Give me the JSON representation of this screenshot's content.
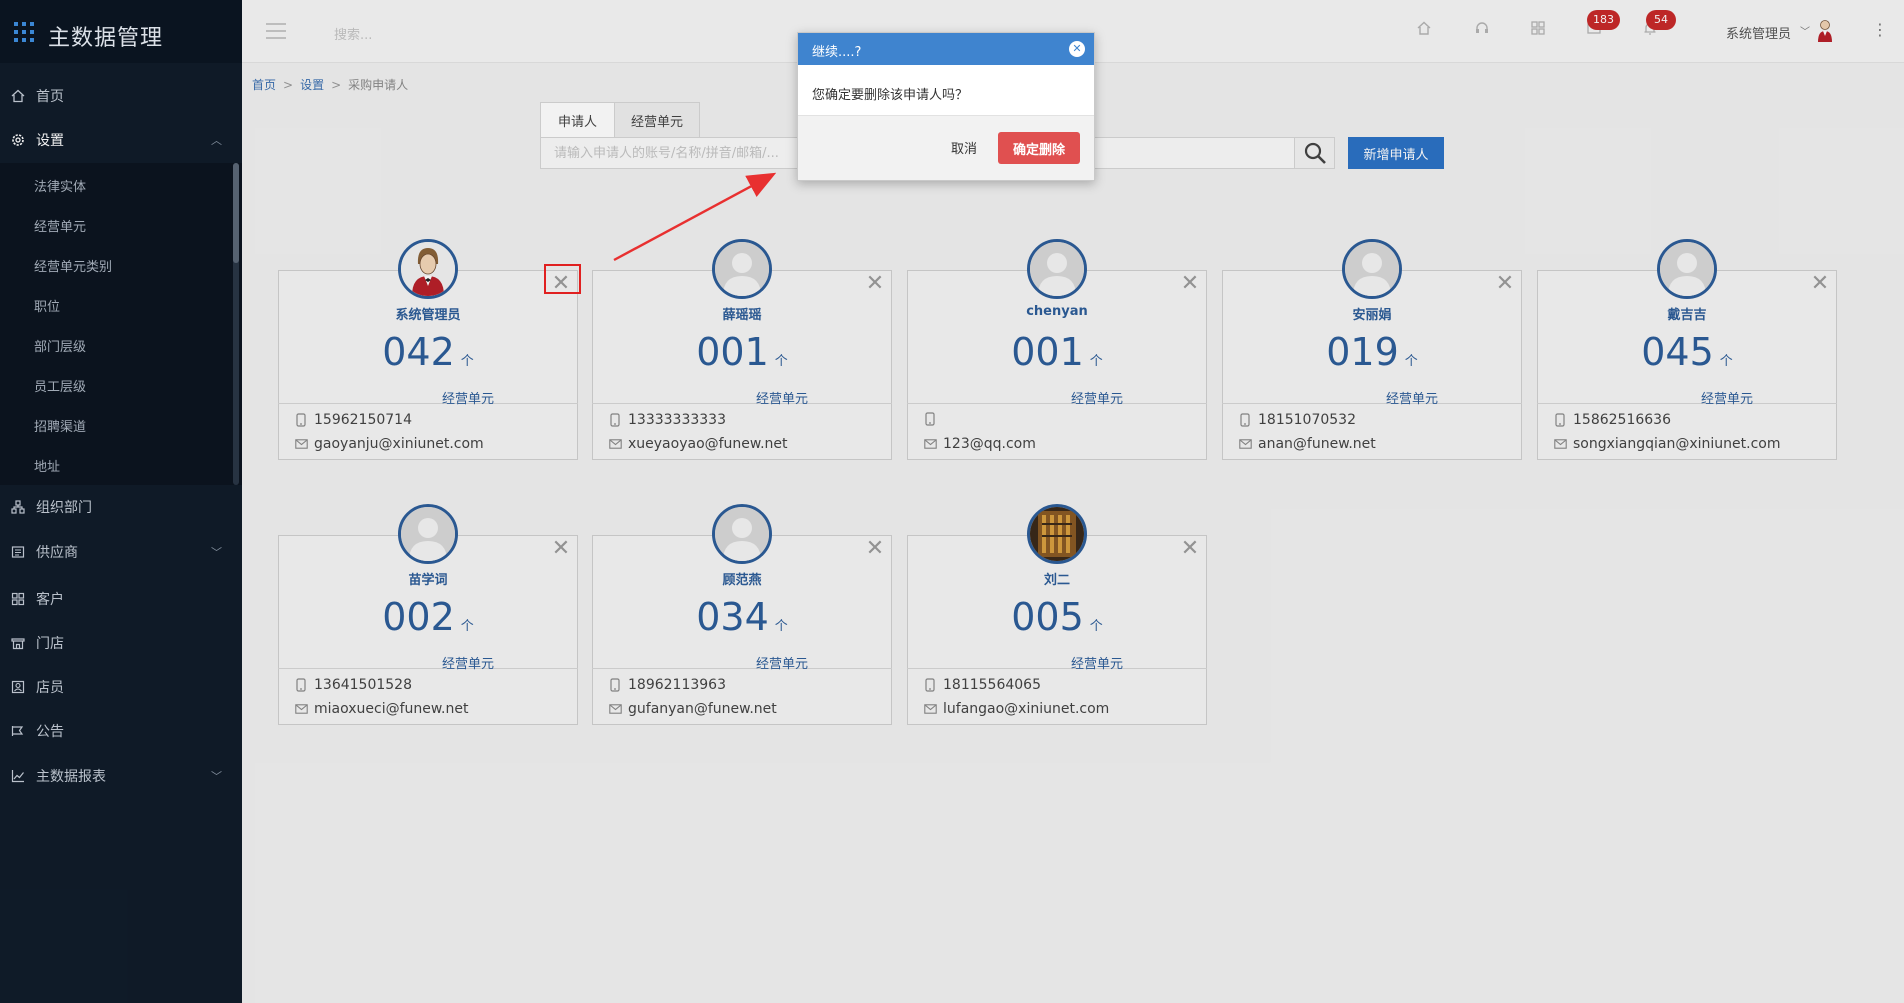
{
  "app": {
    "title": "主数据管理"
  },
  "sidebar": {
    "items": [
      {
        "label": "首页",
        "icon": "home-icon"
      },
      {
        "label": "设置",
        "icon": "gear-icon",
        "expanded": true
      },
      {
        "label": "组织部门",
        "icon": "org-icon"
      },
      {
        "label": "供应商",
        "icon": "supplier-icon"
      },
      {
        "label": "客户",
        "icon": "customer-icon"
      },
      {
        "label": "门店",
        "icon": "store-icon"
      },
      {
        "label": "店员",
        "icon": "clerk-icon"
      },
      {
        "label": "公告",
        "icon": "announcement-icon"
      },
      {
        "label": "主数据报表",
        "icon": "chart-icon"
      }
    ],
    "settings_submenu": [
      "法律实体",
      "经营单元",
      "经营单元类别",
      "职位",
      "部门层级",
      "员工层级",
      "招聘渠道",
      "地址"
    ]
  },
  "header": {
    "search_placeholder": "搜索...",
    "badge_messages": "183",
    "badge_notifications": "54",
    "user_name": "系统管理员"
  },
  "breadcrumb": {
    "home": "首页",
    "settings": "设置",
    "current": "采购申请人",
    "separator": ">"
  },
  "tabs": [
    {
      "label": "申请人",
      "active": true
    },
    {
      "label": "经营单元",
      "active": false
    }
  ],
  "search": {
    "placeholder": "请输入申请人的账号/名称/拼音/邮箱/..."
  },
  "add_button": "新增申请人",
  "unit_suffix": "个",
  "unit_label": "经营单元",
  "cards": [
    {
      "name": "系统管理员",
      "count": "042",
      "phone": "15962150714",
      "email": "gaoyanju@xiniunet.com",
      "avatar": "admin"
    },
    {
      "name": "薛瑶瑶",
      "count": "001",
      "phone": "13333333333",
      "email": "xueyaoyao@funew.net",
      "avatar": "default"
    },
    {
      "name": "chenyan",
      "count": "001",
      "phone": "",
      "email": "123@qq.com",
      "avatar": "default"
    },
    {
      "name": "安丽娟",
      "count": "019",
      "phone": "18151070532",
      "email": "anan@funew.net",
      "avatar": "default"
    },
    {
      "name": "戴吉吉",
      "count": "045",
      "phone": "15862516636",
      "email": "songxiangqian@xiniunet.com",
      "avatar": "default"
    },
    {
      "name": "苗学词",
      "count": "002",
      "phone": "13641501528",
      "email": "miaoxueci@funew.net",
      "avatar": "default"
    },
    {
      "name": "顾范燕",
      "count": "034",
      "phone": "18962113963",
      "email": "gufanyan@funew.net",
      "avatar": "default"
    },
    {
      "name": "刘二",
      "count": "005",
      "phone": "18115564065",
      "email": "lufangao@xiniunet.com",
      "avatar": "photo"
    }
  ],
  "dialog": {
    "title": "继续....?",
    "message": "您确定要删除该申请人吗？",
    "cancel": "取消",
    "confirm": "确定删除"
  },
  "colors": {
    "sidebar": "#101c2a",
    "accent": "#2c72c6",
    "card_text": "#2d5d99",
    "danger": "#e05050",
    "badge": "#c82a2a"
  }
}
